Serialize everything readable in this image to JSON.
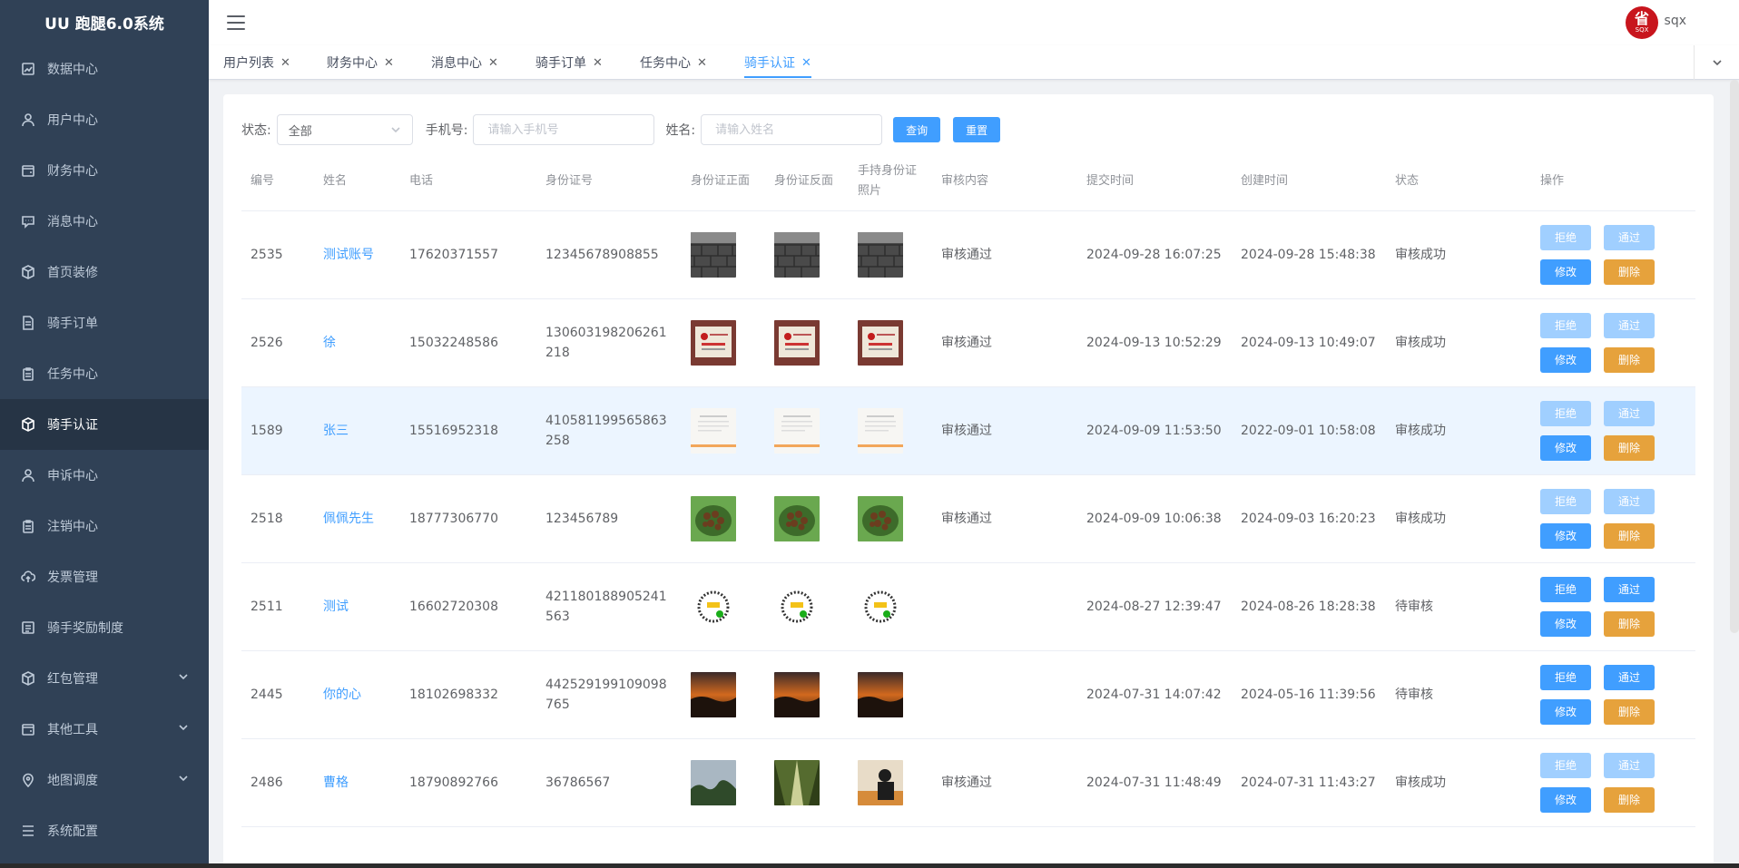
{
  "app": {
    "title": "UU 跑腿6.0系统"
  },
  "sidebar": {
    "items": [
      {
        "label": "数据中心",
        "icon": "chart-icon",
        "active": false
      },
      {
        "label": "用户中心",
        "icon": "user-icon",
        "active": false
      },
      {
        "label": "财务中心",
        "icon": "wallet-icon",
        "active": false
      },
      {
        "label": "消息中心",
        "icon": "message-icon",
        "active": false
      },
      {
        "label": "首页装修",
        "icon": "box-icon",
        "active": false
      },
      {
        "label": "骑手订单",
        "icon": "document-icon",
        "active": false
      },
      {
        "label": "任务中心",
        "icon": "clipboard-icon",
        "active": false
      },
      {
        "label": "骑手认证",
        "icon": "box-icon",
        "active": true
      },
      {
        "label": "申诉中心",
        "icon": "user-icon",
        "active": false
      },
      {
        "label": "注销中心",
        "icon": "clipboard-icon",
        "active": false
      },
      {
        "label": "发票管理",
        "icon": "cloud-upload-icon",
        "active": false
      },
      {
        "label": "骑手奖励制度",
        "icon": "list-icon",
        "active": false
      },
      {
        "label": "红包管理",
        "icon": "box-icon",
        "active": false,
        "expandable": true
      },
      {
        "label": "其他工具",
        "icon": "wallet-icon",
        "active": false,
        "expandable": true
      },
      {
        "label": "地图调度",
        "icon": "location-icon",
        "active": false,
        "expandable": true
      },
      {
        "label": "系统配置",
        "icon": "menu-lines-icon",
        "active": false
      }
    ]
  },
  "header": {
    "avatar_text": "省",
    "avatar_sub": "SQX",
    "username": "sqx"
  },
  "tabs": [
    {
      "label": "用户列表",
      "active": false
    },
    {
      "label": "财务中心",
      "active": false
    },
    {
      "label": "消息中心",
      "active": false
    },
    {
      "label": "骑手订单",
      "active": false
    },
    {
      "label": "任务中心",
      "active": false
    },
    {
      "label": "骑手认证",
      "active": true
    }
  ],
  "filters": {
    "status_label": "状态:",
    "status_value": "全部",
    "phone_label": "手机号:",
    "phone_placeholder": "请输入手机号",
    "name_label": "姓名:",
    "name_placeholder": "请输入姓名",
    "search_label": "查询",
    "reset_label": "重置"
  },
  "table": {
    "columns": [
      "编号",
      "姓名",
      "电话",
      "身份证号",
      "身份证正面",
      "身份证反面",
      "手持身份证照片",
      "审核内容",
      "提交时间",
      "创建时间",
      "状态",
      "操作"
    ],
    "actions": {
      "reject": "拒绝",
      "approve": "通过",
      "edit": "修改",
      "delete": "删除"
    },
    "rows": [
      {
        "id": "2535",
        "name": "测试账号",
        "phone": "17620371557",
        "idcard": "12345678908855",
        "images": [
          "brick",
          "brick",
          "brick"
        ],
        "audit": "审核通过",
        "submit_time": "2024-09-28 16:07:25",
        "create_time": "2024-09-28 15:48:38",
        "status": "审核成功",
        "pending": false
      },
      {
        "id": "2526",
        "name": "徐",
        "phone": "15032248586",
        "idcard": "130603198206261218",
        "images": [
          "idcard",
          "idcard",
          "idcard"
        ],
        "audit": "审核通过",
        "submit_time": "2024-09-13 10:52:29",
        "create_time": "2024-09-13 10:49:07",
        "status": "审核成功",
        "pending": false
      },
      {
        "id": "1589",
        "name": "张三",
        "phone": "15516952318",
        "idcard": "410581199565863258",
        "images": [
          "paper",
          "paper",
          "paper"
        ],
        "audit": "审核通过",
        "submit_time": "2024-09-09 11:53:50",
        "create_time": "2022-09-01 10:58:08",
        "status": "审核成功",
        "pending": false,
        "highlight": true
      },
      {
        "id": "2518",
        "name": "佩佩先生",
        "phone": "18777306770",
        "idcard": "123456789",
        "images": [
          "food",
          "food",
          "food"
        ],
        "audit": "审核通过",
        "submit_time": "2024-09-09 10:06:38",
        "create_time": "2024-09-03 16:20:23",
        "status": "审核成功",
        "pending": false
      },
      {
        "id": "2511",
        "name": "测试",
        "phone": "16602720308",
        "idcard": "421180188905241563",
        "images": [
          "qr",
          "qr",
          "qr"
        ],
        "audit": "",
        "submit_time": "2024-08-27 12:39:47",
        "create_time": "2024-08-26 18:28:38",
        "status": "待审核",
        "pending": true
      },
      {
        "id": "2445",
        "name": "你的心",
        "phone": "18102698332",
        "idcard": "442529199109098765",
        "images": [
          "sunset",
          "sunset",
          "sunset"
        ],
        "audit": "",
        "submit_time": "2024-07-31 14:07:42",
        "create_time": "2024-05-16 11:39:56",
        "status": "待审核",
        "pending": true
      },
      {
        "id": "2486",
        "name": "曹格",
        "phone": "18790892766",
        "idcard": "36786567",
        "images": [
          "sky",
          "forest",
          "person"
        ],
        "audit": "审核通过",
        "submit_time": "2024-07-31 11:48:49",
        "create_time": "2024-07-31 11:43:27",
        "status": "审核成功",
        "pending": false
      }
    ]
  },
  "colors": {
    "primary": "#409eff",
    "warning": "#e6a23c",
    "disabled": "#a0cfff",
    "sidebar": "#304156"
  }
}
